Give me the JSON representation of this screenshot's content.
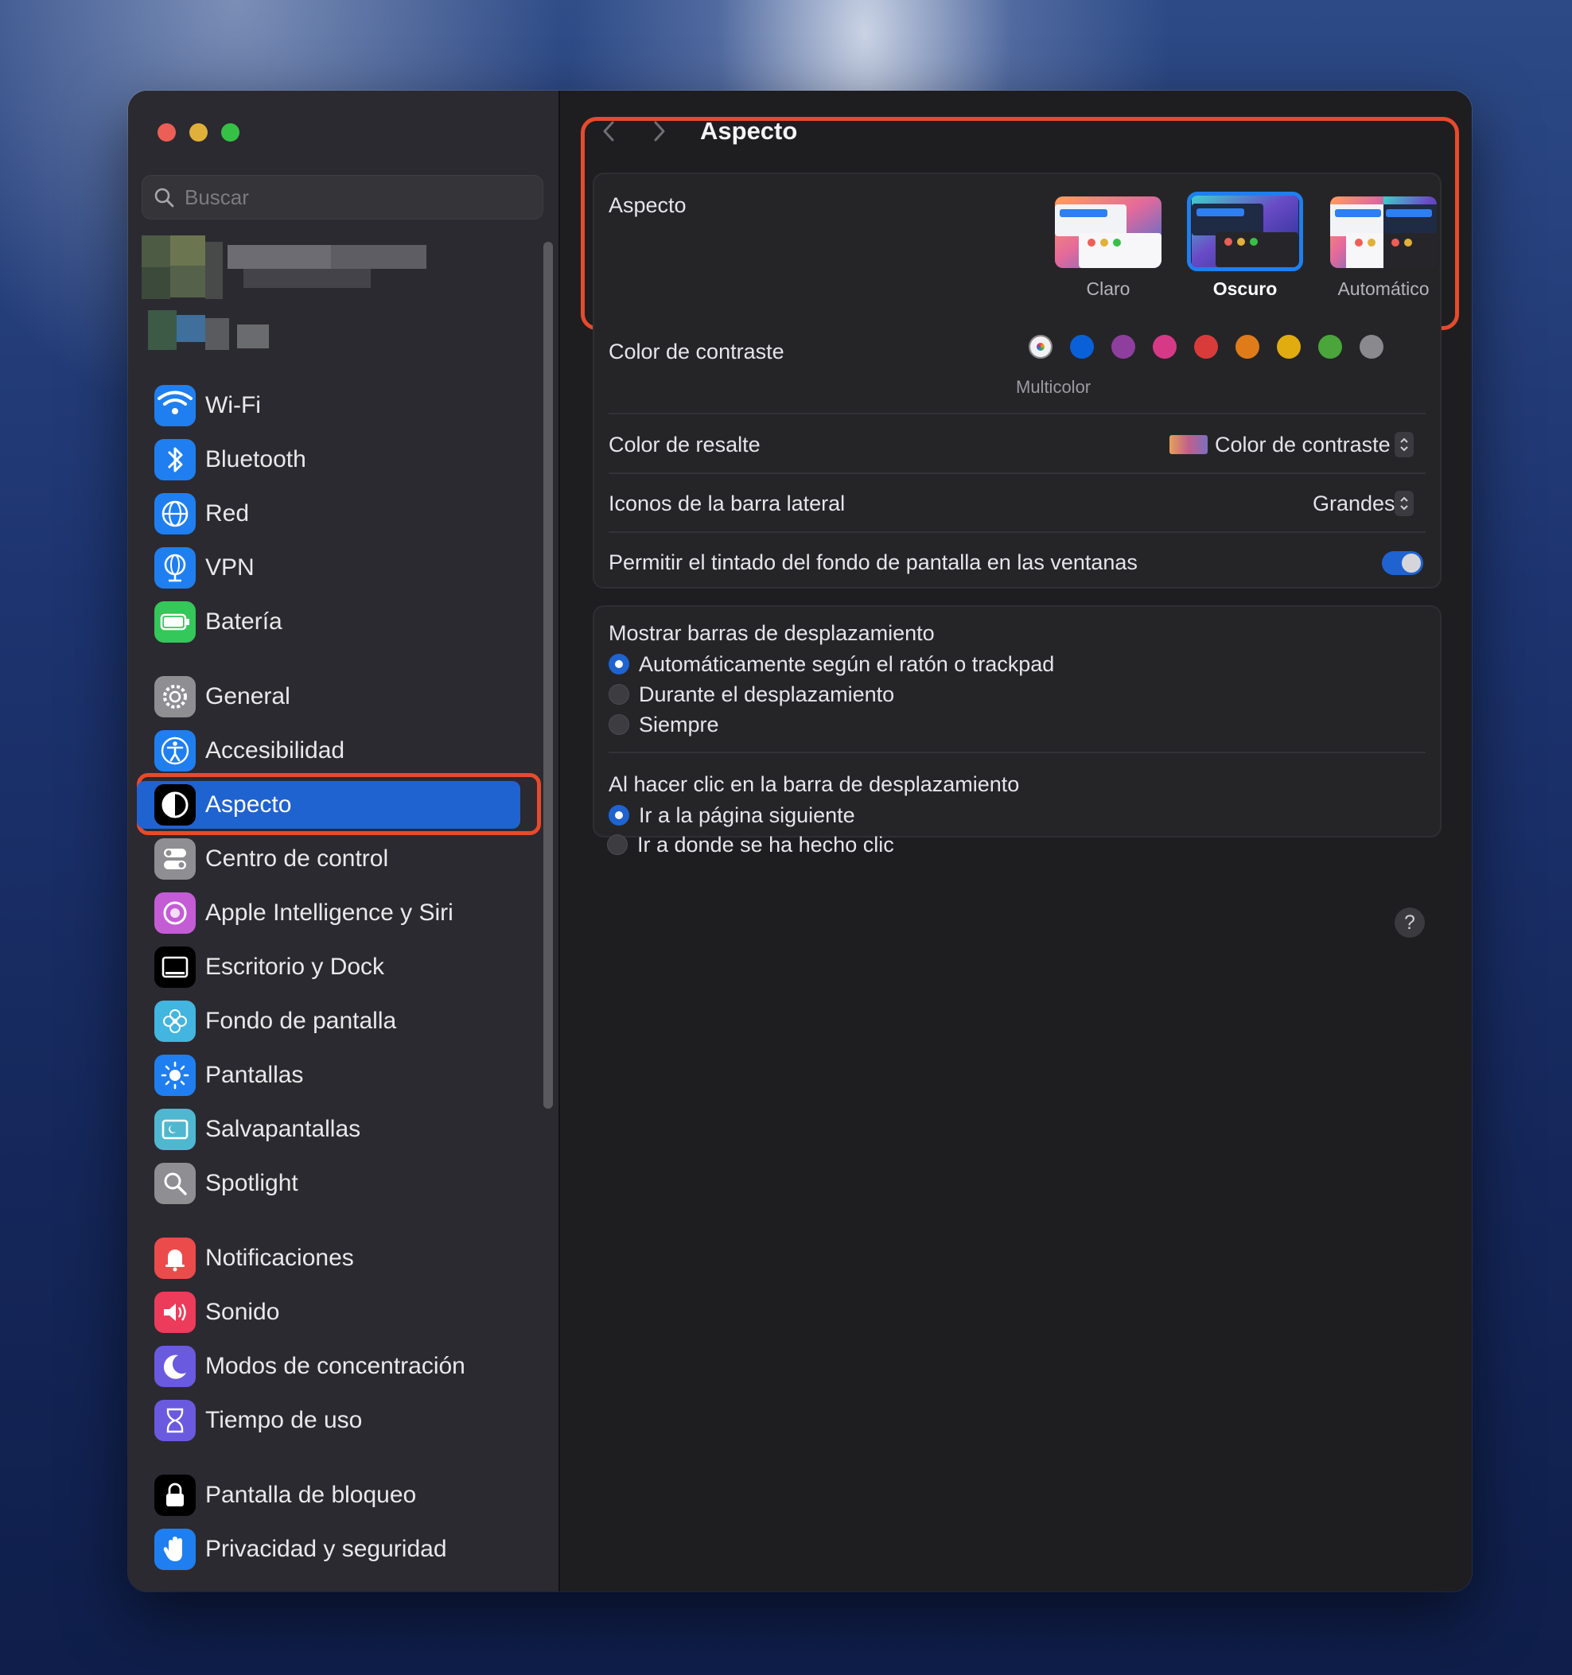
{
  "search": {
    "placeholder": "Buscar"
  },
  "sidebar": {
    "items": [
      {
        "label": "Wi-Fi",
        "icon": "wifi-icon",
        "color": "#1f7ff0"
      },
      {
        "label": "Bluetooth",
        "icon": "bluetooth-icon",
        "color": "#1f7ff0"
      },
      {
        "label": "Red",
        "icon": "globe-icon",
        "color": "#1f7ff0"
      },
      {
        "label": "VPN",
        "icon": "vpn-globe-icon",
        "color": "#1f7ff0"
      },
      {
        "label": "Batería",
        "icon": "battery-icon",
        "color": "#34c759"
      },
      {
        "label": "General",
        "icon": "gear-icon",
        "color": "#8e8e93"
      },
      {
        "label": "Accesibilidad",
        "icon": "accessibility-icon",
        "color": "#1f7ff0"
      },
      {
        "label": "Aspecto",
        "icon": "appearance-icon",
        "color": "#000000",
        "selected": true
      },
      {
        "label": "Centro de control",
        "icon": "control-center-icon",
        "color": "#8e8e93"
      },
      {
        "label": "Apple Intelligence y Siri",
        "icon": "siri-icon",
        "color": "#c45cd6"
      },
      {
        "label": "Escritorio y Dock",
        "icon": "dock-icon",
        "color": "#000000"
      },
      {
        "label": "Fondo de pantalla",
        "icon": "flower-icon",
        "color": "#42b5e0"
      },
      {
        "label": "Pantallas",
        "icon": "sun-icon",
        "color": "#1f7ff0"
      },
      {
        "label": "Salvapantallas",
        "icon": "screensaver-icon",
        "color": "#4fb8d0"
      },
      {
        "label": "Spotlight",
        "icon": "magnifier-icon",
        "color": "#8e8e93"
      },
      {
        "label": "Notificaciones",
        "icon": "bell-icon",
        "color": "#ec4b4b"
      },
      {
        "label": "Sonido",
        "icon": "speaker-icon",
        "color": "#ec3b5b"
      },
      {
        "label": "Modos de concentración",
        "icon": "moon-icon",
        "color": "#6a5adf"
      },
      {
        "label": "Tiempo de uso",
        "icon": "hourglass-icon",
        "color": "#6a5adf"
      },
      {
        "label": "Pantalla de bloqueo",
        "icon": "lock-icon",
        "color": "#000000"
      },
      {
        "label": "Privacidad y seguridad",
        "icon": "hand-icon",
        "color": "#1f7ff0"
      }
    ]
  },
  "main": {
    "title": "Aspecto",
    "appearance": {
      "label": "Aspecto",
      "options": [
        {
          "label": "Claro",
          "selected": false
        },
        {
          "label": "Oscuro",
          "selected": true
        },
        {
          "label": "Automático",
          "selected": false
        }
      ]
    },
    "accent": {
      "label": "Color de contraste",
      "caption": "Multicolor",
      "colors": [
        "multicolor",
        "#0a60d8",
        "#8e3f9e",
        "#d63a86",
        "#d93b3b",
        "#e07b1a",
        "#e0ac10",
        "#4aa53b",
        "#8a8a8e"
      ]
    },
    "highlight": {
      "label": "Color de resalte",
      "value": "Color de contraste"
    },
    "sidebar_icons": {
      "label": "Iconos de la barra lateral",
      "value": "Grandes"
    },
    "tinting": {
      "label": "Permitir el tintado del fondo de pantalla en las ventanas",
      "on": true
    },
    "scrollbars": {
      "label": "Mostrar barras de desplazamiento",
      "options": [
        "Automáticamente según el ratón o trackpad",
        "Durante el desplazamiento",
        "Siempre"
      ],
      "selected": 0
    },
    "click": {
      "label": "Al hacer clic en la barra de desplazamiento",
      "options": [
        "Ir a la página siguiente",
        "Ir a donde se ha hecho clic"
      ],
      "selected": 0
    },
    "help": "?"
  }
}
